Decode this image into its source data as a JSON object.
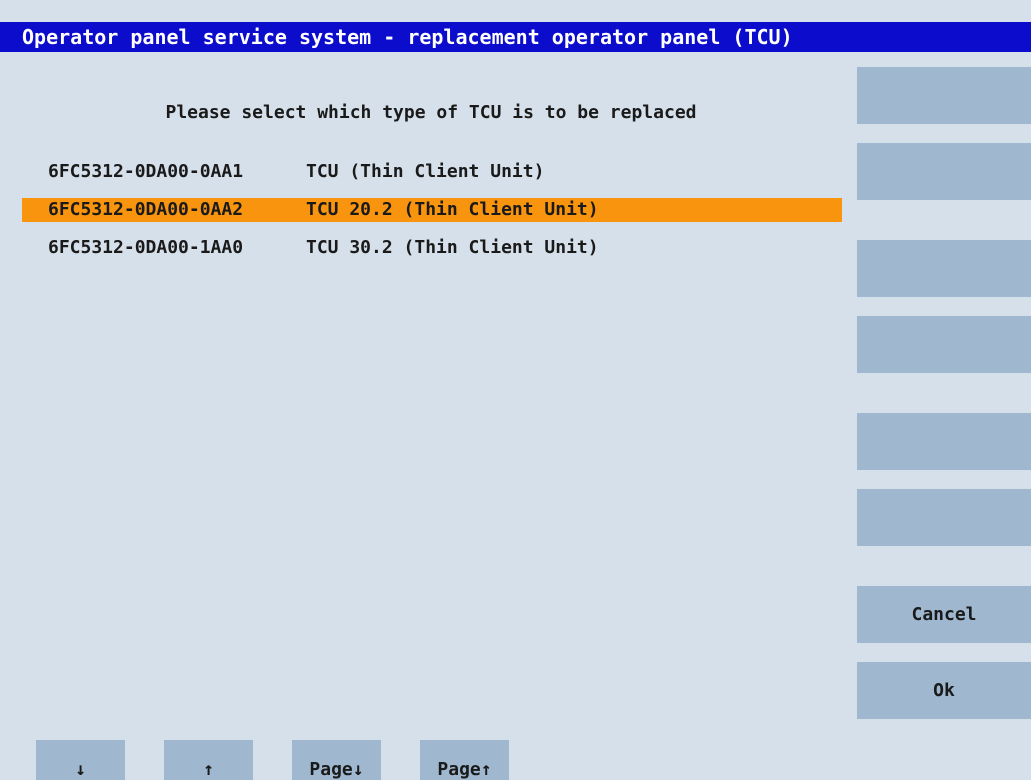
{
  "title": "Operator panel service system - replacement operator panel (TCU)",
  "prompt": "Please select which type of TCU is to be replaced",
  "list": {
    "items": [
      {
        "code": "6FC5312-0DA00-0AA1",
        "desc": "TCU (Thin Client Unit)",
        "selected": false
      },
      {
        "code": "6FC5312-0DA00-0AA2",
        "desc": "TCU 20.2 (Thin Client Unit)",
        "selected": true
      },
      {
        "code": "6FC5312-0DA00-1AA0",
        "desc": "TCU 30.2 (Thin Client Unit)",
        "selected": false
      }
    ]
  },
  "vertical_softkeys": {
    "labels": [
      "",
      "",
      "",
      "",
      "",
      "",
      "Cancel",
      "Ok"
    ]
  },
  "horizontal_softkeys": {
    "labels": [
      "↓",
      "↑",
      "Page↓",
      "Page↑"
    ]
  },
  "colors": {
    "titlebar": "#0c0ccc",
    "background": "#d6e0ea",
    "softkey": "#9fb8d0",
    "selection": "#f9940e"
  }
}
